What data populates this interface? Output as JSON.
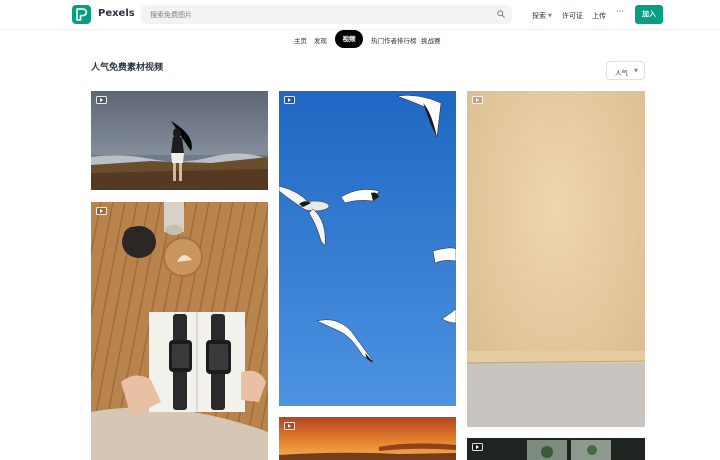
{
  "header": {
    "brand": "Pexels",
    "search_placeholder": "搜索免费图片",
    "nav": [
      {
        "label": "探索",
        "has_caret": true
      },
      {
        "label": "许可证",
        "has_caret": false
      },
      {
        "label": "上传",
        "has_caret": false
      }
    ],
    "more_label": "···",
    "join_label": "加入"
  },
  "tabs": [
    {
      "label": "主页",
      "active": false
    },
    {
      "label": "发现",
      "active": false
    },
    {
      "label": "视频",
      "active": true
    },
    {
      "label": "热门作者排行榜",
      "active": false
    },
    {
      "label": "挑战赛",
      "active": false
    }
  ],
  "section": {
    "title": "人气免费素材视频",
    "sort_label": "人气"
  },
  "colors": {
    "brand_green": "#05a081",
    "text_dark": "#2c343e",
    "search_bg": "#f3f3f3"
  },
  "videos": [
    {
      "name": "woman-on-shore",
      "icon": "play-icon"
    },
    {
      "name": "watch-magazine",
      "icon": "play-icon"
    },
    {
      "name": "seagulls-sky",
      "icon": "play-icon"
    },
    {
      "name": "sunset-clouds",
      "icon": "play-icon"
    },
    {
      "name": "beige-wall-floor",
      "icon": "play-icon"
    },
    {
      "name": "dark-window-plants",
      "icon": "play-icon"
    }
  ]
}
